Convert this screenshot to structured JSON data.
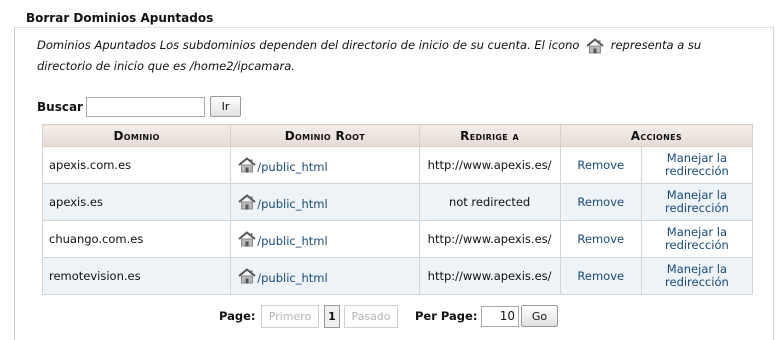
{
  "title": "Borrar Dominios Apuntados",
  "description": {
    "before_icon": "Dominios Apuntados Los subdominios dependen del directorio de inicio de su cuenta. El icono",
    "after_icon": "representa a su directorio de inicio que es /home2/ipcamara.",
    "icon": "home-icon"
  },
  "search": {
    "label": "Buscar",
    "value": "",
    "button": "Ir"
  },
  "table": {
    "columns": [
      "Dominio",
      "Dominio Root",
      "Redirige a",
      "Acciones"
    ],
    "rows": [
      {
        "domain": "apexis.com.es",
        "root": "/public_html",
        "redirect": "http://www.apexis.es/",
        "remove": "Remove",
        "manage": "Manejar la redirección"
      },
      {
        "domain": "apexis.es",
        "root": "/public_html",
        "redirect": "not redirected",
        "remove": "Remove",
        "manage": "Manejar la redirección"
      },
      {
        "domain": "chuango.com.es",
        "root": "/public_html",
        "redirect": "http://www.apexis.es/",
        "remove": "Remove",
        "manage": "Manejar la redirección"
      },
      {
        "domain": "remotevision.es",
        "root": "/public_html",
        "redirect": "http://www.apexis.es/",
        "remove": "Remove",
        "manage": "Manejar la redirección"
      }
    ]
  },
  "pagination": {
    "page_label": "Page:",
    "first": "Primero",
    "current": "1",
    "last": "Pasado",
    "per_page_label": "Per Page:",
    "per_page_value": "10",
    "go_button": "Go"
  },
  "colors": {
    "link": "#184a78",
    "header_bg": "#e6dcd6",
    "row_alt_bg": "#eef3f8"
  }
}
